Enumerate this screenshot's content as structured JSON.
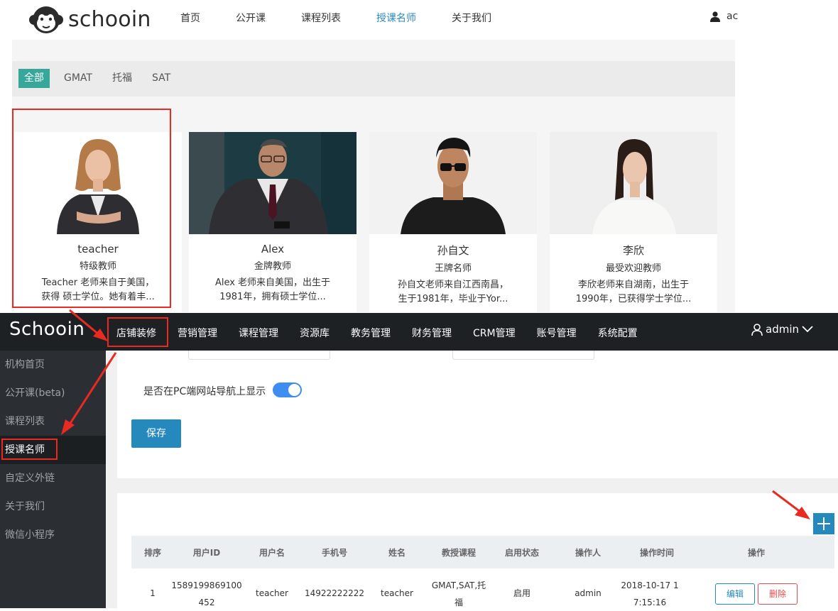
{
  "site": {
    "logo_text": "schooin",
    "nav": [
      "首页",
      "公开课",
      "课程列表",
      "授课名师",
      "关于我们"
    ],
    "active_nav": "授课名师",
    "user_text": "ac"
  },
  "filters": [
    "全部",
    "GMAT",
    "托福",
    "SAT"
  ],
  "teachers": [
    {
      "name": "teacher",
      "title": "特级教师",
      "desc_line1": "Teacher 老师来自于美国，",
      "desc_line2": "获得 硕士学位。她有着丰..."
    },
    {
      "name": "Alex",
      "title": "金牌教师",
      "desc_line1": "Alex 老师来自美国，出生于",
      "desc_line2": "1981年，拥有硕士学位..."
    },
    {
      "name": "孙自文",
      "title": "王牌名师",
      "desc_line1": "孙自文老师来自江西南昌，",
      "desc_line2": "生于1981年，毕业于Yor..."
    },
    {
      "name": "李欣",
      "title": "最受欢迎教师",
      "desc_line1": "李欣老师来自湖南，出生于",
      "desc_line2": "1990年，已获得学士学位..."
    }
  ],
  "admin": {
    "logo": "Schooin",
    "nav": [
      "店铺装修",
      "营销管理",
      "课程管理",
      "资源库",
      "教务管理",
      "财务管理",
      "CRM管理",
      "账号管理",
      "系统配置"
    ],
    "user": "admin"
  },
  "sidebar": [
    "机构首页",
    "公开课(beta)",
    "课程列表",
    "授课名师",
    "自定义外链",
    "关于我们",
    "微信小程序"
  ],
  "settings": {
    "toggle_label": "是否在PC端网站导航上显示",
    "toggle_on": true,
    "save_label": "保存"
  },
  "table": {
    "headers": [
      "排序",
      "用户ID",
      "用户名",
      "手机号",
      "姓名",
      "教授课程",
      "启用状态",
      "操作人",
      "操作时间",
      "操作"
    ],
    "rows": [
      {
        "order": "1",
        "user_id_1": "1589199869100",
        "user_id_2": "452",
        "username": "teacher",
        "phone": "14922222222",
        "name": "teacher",
        "courses_1": "GMAT,SAT,托",
        "courses_2": "福",
        "status": "启用",
        "operator": "admin",
        "time_1": "2018-10-17 1",
        "time_2": "7:15:16",
        "edit": "编辑",
        "delete": "删除"
      }
    ]
  },
  "colors": {
    "accent": "#36a79a",
    "primary": "#2589bd",
    "annotation": "#e82a20",
    "admin_dark": "#1e2124"
  }
}
